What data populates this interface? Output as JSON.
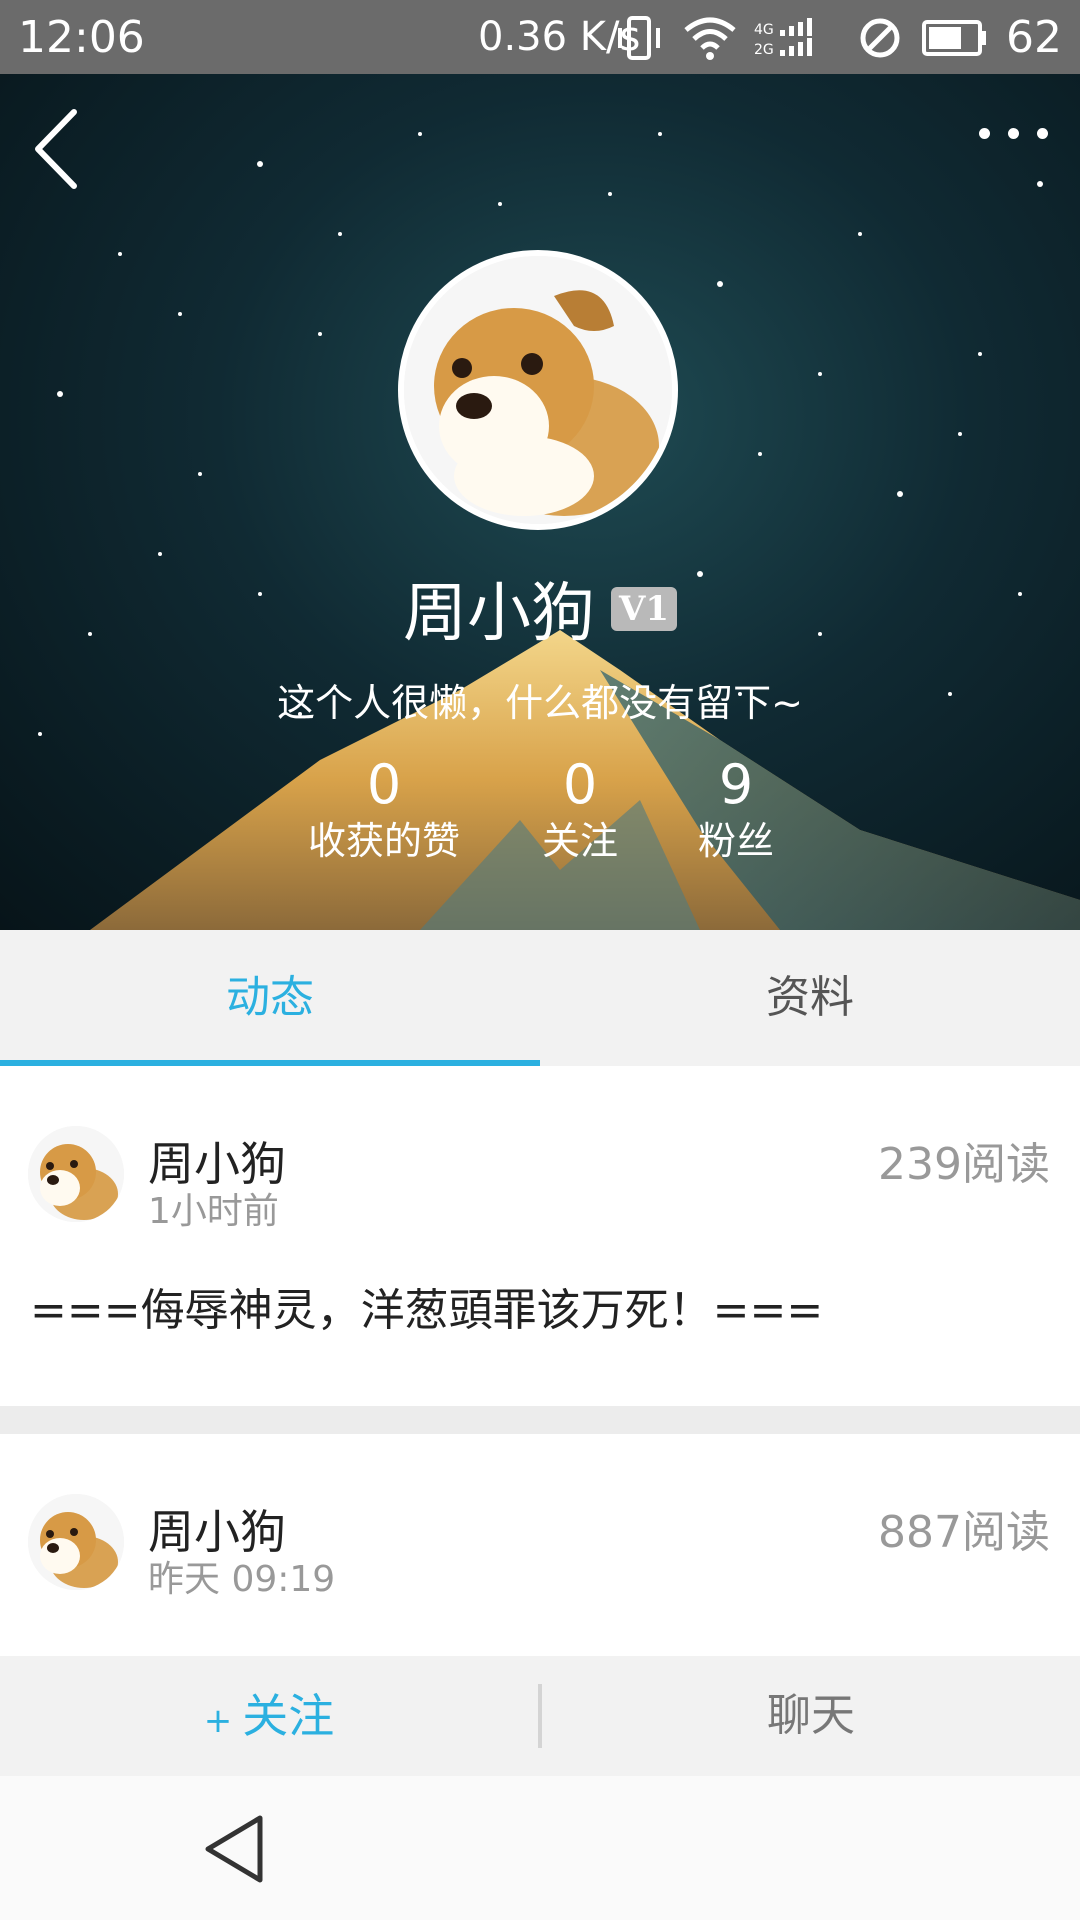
{
  "status_bar": {
    "time": "12:06",
    "speed": "0.36 K/s",
    "battery": "62",
    "icons": [
      "vibrate-icon",
      "wifi-icon",
      "signal-icon",
      "do-not-disturb-icon",
      "battery-icon"
    ]
  },
  "profile": {
    "name": "周小狗",
    "badge": "V1",
    "bio": "这个人很懒，什么都没有留下~",
    "stats": [
      {
        "value": "0",
        "label": "收获的赞"
      },
      {
        "value": "0",
        "label": "关注"
      },
      {
        "value": "9",
        "label": "粉丝"
      }
    ]
  },
  "tabs": [
    {
      "label": "动态",
      "active": true
    },
    {
      "label": "资料",
      "active": false
    }
  ],
  "feed": [
    {
      "author": "周小狗",
      "time": "1小时前",
      "reads": "239阅读",
      "content": "===侮辱神灵，洋葱頭罪该万死！==="
    },
    {
      "author": "周小狗",
      "time": "昨天 09:19",
      "reads": "887阅读",
      "content": ""
    }
  ],
  "actions": {
    "follow_plus": "+",
    "follow": "关注",
    "chat": "聊天"
  },
  "colors": {
    "accent": "#2bb0e0",
    "status_bar": "#6b6b6b"
  }
}
